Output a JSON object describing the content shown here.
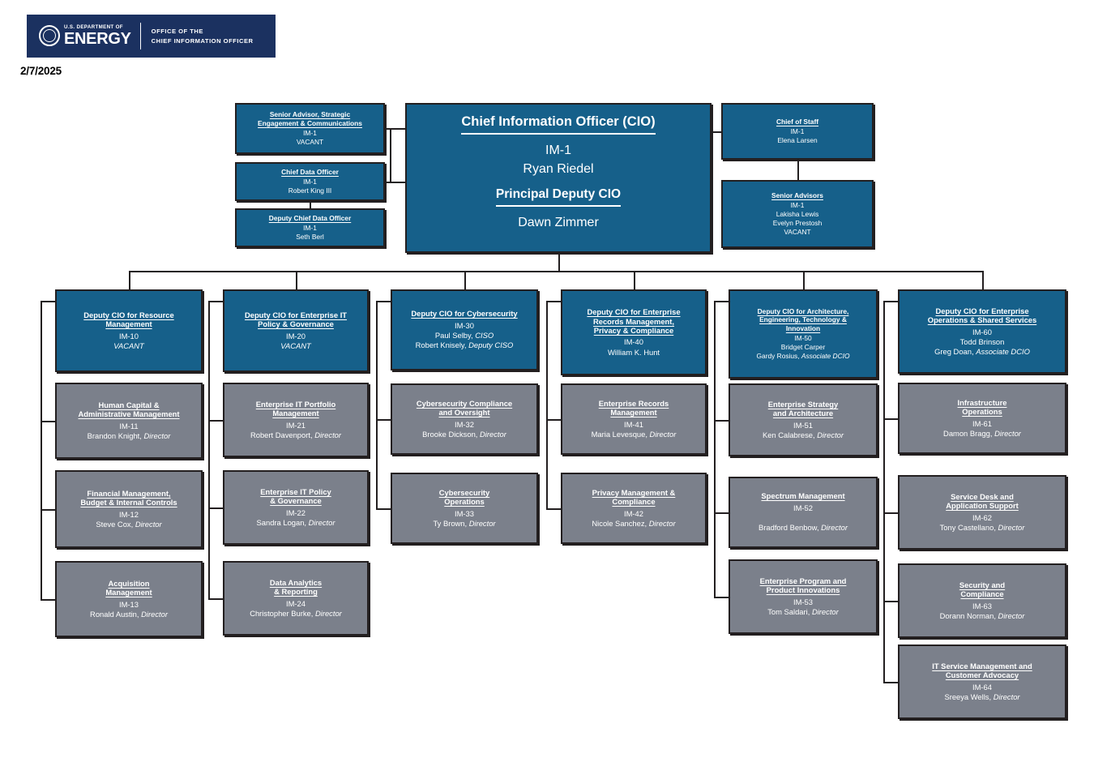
{
  "header": {
    "agency_dept_line": "U.S. DEPARTMENT OF",
    "agency_name": "ENERGY",
    "office_line1": "OFFICE OF THE",
    "office_line2": "CHIEF INFORMATION OFFICER",
    "seal_icon": "doe-seal-icon"
  },
  "chart_date": "2/7/2025",
  "colors": {
    "banner_navy": "#1B3160",
    "executive_blue": "#16608A",
    "office_gray": "#7B808B",
    "border_black": "#231F20",
    "text_white": "#FFFFFF"
  },
  "cio": {
    "title": "Chief Information Officer (CIO)",
    "code": "IM-1",
    "name": "Ryan Riedel",
    "deputy_title": "Principal Deputy CIO",
    "deputy_name": "Dawn Zimmer"
  },
  "left_staff": [
    {
      "title": "Senior Advisor, Strategic Engagement & Communications",
      "title_l1": "Senior Advisor, Strategic",
      "title_l2": "Engagement & Communications",
      "code": "IM-1",
      "people": [
        "VACANT"
      ]
    },
    {
      "title": "Chief Data Officer",
      "code": "IM-1",
      "people": [
        "Robert King III"
      ]
    },
    {
      "title": "Deputy Chief Data Officer",
      "code": "IM-1",
      "people": [
        "Seth Berl"
      ]
    }
  ],
  "right_staff": [
    {
      "title": "Chief of Staff",
      "code": "IM-1",
      "people": [
        "Elena Larsen"
      ]
    },
    {
      "title": "Senior Advisors",
      "code": "IM-1",
      "people": [
        "Lakisha Lewis",
        "Evelyn Prestosh",
        "VACANT"
      ]
    }
  ],
  "columns": [
    {
      "head": {
        "title_l1": "Deputy CIO for Resource",
        "title_l2": "Management",
        "code": "IM-10",
        "name": "VACANT",
        "name_italic": true,
        "role": ""
      },
      "children": [
        {
          "title_l1": "Human Capital &",
          "title_l2": "Administrative Management",
          "code": "IM-11",
          "name": "Brandon Knight,",
          "role": "Director"
        },
        {
          "title_l1": "Financial Management,",
          "title_l2": "Budget & Internal Controls",
          "code": "IM-12",
          "name": "Steve Cox,",
          "role": "Director"
        },
        {
          "title_l1": "Acquisition",
          "title_l2": "Management",
          "code": "IM-13",
          "name": "Ronald Austin,",
          "role": "Director"
        }
      ]
    },
    {
      "head": {
        "title_l1": "Deputy CIO for Enterprise IT",
        "title_l2": "Policy & Governance",
        "code": "IM-20",
        "name": "VACANT",
        "name_italic": true,
        "role": ""
      },
      "children": [
        {
          "title_l1": "Enterprise IT Portfolio",
          "title_l2": "Management",
          "code": "IM-21",
          "name": "Robert Davenport,",
          "role": "Director"
        },
        {
          "title_l1": "Enterprise IT Policy",
          "title_l2": "& Governance",
          "code": "IM-22",
          "name": "Sandra Logan,",
          "role": "Director"
        },
        {
          "title_l1": "Data Analytics",
          "title_l2": "& Reporting",
          "code": "IM-24",
          "name": "Christopher Burke,",
          "role": "Director"
        }
      ]
    },
    {
      "head": {
        "title_l1": "Deputy CIO for Cybersecurity",
        "title_l2": "",
        "code": "IM-30",
        "name": "Paul Selby,",
        "role": "CISO",
        "name2": "Robert Knisely,",
        "role2": "Deputy CISO"
      },
      "children": [
        {
          "title_l1": "Cybersecurity Compliance",
          "title_l2": "and Oversight",
          "code": "IM-32",
          "name": "Brooke Dickson,",
          "role": "Director"
        },
        {
          "title_l1": "Cybersecurity",
          "title_l2": "Operations",
          "code": "IM-33",
          "name": "Ty Brown,",
          "role": "Director"
        }
      ]
    },
    {
      "head": {
        "title_l1": "Deputy CIO for Enterprise",
        "title_l2": "Records Management,",
        "title_l3": "Privacy & Compliance",
        "code": "IM-40",
        "name": "William K. Hunt",
        "role": ""
      },
      "children": [
        {
          "title_l1": "Enterprise Records",
          "title_l2": "Management",
          "code": "IM-41",
          "name": "Maria Levesque,",
          "role": "Director"
        },
        {
          "title_l1": "Privacy Management &",
          "title_l2": "Compliance",
          "code": "IM-42",
          "name": "Nicole Sanchez,",
          "role": "Director"
        }
      ]
    },
    {
      "head": {
        "title_l1": "Deputy CIO for Architecture,",
        "title_l2": "Engineering, Technology &",
        "title_l3": "Innovation",
        "code": "IM-50",
        "name": "Bridget Carper",
        "role": "",
        "name2": "Gardy Rosius,",
        "role2": "Associate DCIO"
      },
      "children": [
        {
          "title_l1": "Enterprise Strategy",
          "title_l2": "and Architecture",
          "code": "IM-51",
          "name": "Ken Calabrese,",
          "role": "Director"
        },
        {
          "title_l1": "Spectrum Management",
          "title_l2": "",
          "code": "IM-52",
          "name": "Bradford Benbow,",
          "role": "Director",
          "spaced": true
        },
        {
          "title_l1": "Enterprise Program and",
          "title_l2": "Product Innovations",
          "code": "IM-53",
          "name": "Tom Saldari,",
          "role": "Director"
        }
      ]
    },
    {
      "head": {
        "title_l1": "Deputy CIO for Enterprise",
        "title_l2": "Operations & Shared Services",
        "code": "IM-60",
        "name": "Todd Brinson",
        "role": "",
        "name2": "Greg Doan,",
        "role2": "Associate DCIO"
      },
      "children": [
        {
          "title_l1": "Infrastructure",
          "title_l2": "Operations",
          "code": "IM-61",
          "name": "Damon Bragg,",
          "role": "Director"
        },
        {
          "title_l1": "Service Desk and",
          "title_l2": "Application Support",
          "code": "IM-62",
          "name": "Tony Castellano,",
          "role": "Director"
        },
        {
          "title_l1": "Security and",
          "title_l2": "Compliance",
          "code": "IM-63",
          "name": "Dorann Norman,",
          "role": "Director"
        },
        {
          "title_l1": "IT Service Management and",
          "title_l2": "Customer Advocacy",
          "code": "IM-64",
          "name": "Sreeya Wells,",
          "role": "Director"
        }
      ]
    }
  ]
}
